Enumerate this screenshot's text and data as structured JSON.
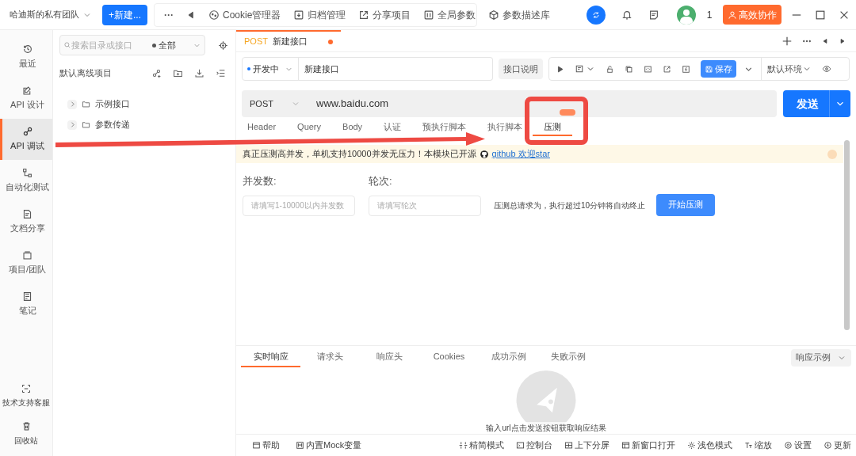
{
  "app_bar": {
    "team": "哈迪斯的私有团队",
    "new_button": "+新建...",
    "more": "···",
    "tools": [
      {
        "label": "Cookie管理器"
      },
      {
        "label": "归档管理"
      },
      {
        "label": "分享项目"
      },
      {
        "label": "全局参数"
      },
      {
        "label": "参数描述库"
      }
    ],
    "user_count": "1",
    "collab_button": "高效协作"
  },
  "nav": {
    "items": [
      {
        "label": "最近",
        "selected": false
      },
      {
        "label": "API 设计",
        "selected": false
      },
      {
        "label": "API 调试",
        "selected": true
      },
      {
        "label": "自动化测试",
        "selected": false
      },
      {
        "label": "文档分享",
        "selected": false
      },
      {
        "label": "项目/团队",
        "selected": false
      },
      {
        "label": "笔记",
        "selected": false
      }
    ],
    "bottom_items": [
      {
        "label": "技术支持客服"
      },
      {
        "label": "回收站"
      }
    ]
  },
  "tree": {
    "search_placeholder": "搜索目录或接口",
    "filter": "全部",
    "project": "默认离线项目",
    "folders": [
      {
        "label": "示例接口",
        "expanded": false
      },
      {
        "label": "参数传递",
        "expanded": false
      }
    ]
  },
  "tab": {
    "method": "POST",
    "name": "新建接口",
    "unsaved": true
  },
  "request": {
    "status": "开发中",
    "name": "新建接口",
    "doc_button": "接口说明",
    "save_button": "保存",
    "environment": "默认环境",
    "method": "POST",
    "url": "www.baidu.com",
    "send_button": "发送"
  },
  "request_tabs": [
    {
      "label": "Header",
      "selected": false,
      "badge": false
    },
    {
      "label": "Query",
      "selected": false,
      "badge": false
    },
    {
      "label": "Body",
      "selected": false,
      "badge": false
    },
    {
      "label": "认证",
      "selected": false,
      "badge": false
    },
    {
      "label": "预执行脚本",
      "selected": false,
      "badge": false
    },
    {
      "label": "执行脚本",
      "selected": false,
      "badge": false
    },
    {
      "label": "压测",
      "selected": true,
      "badge": true
    }
  ],
  "banner": {
    "text": "真正压测高并发，单机支持10000并发无压力！本模块已开源",
    "link": "github 欢迎star"
  },
  "load_test": {
    "concurrency_label": "并发数:",
    "concurrency_placeholder": "请填写1-10000以内并发数",
    "rounds_label": "轮次:",
    "rounds_placeholder": "请填写轮次",
    "note": "压测总请求为，执行超过10分钟将自动终止",
    "start_button": "开始压测"
  },
  "response": {
    "tabs": [
      {
        "label": "实时响应",
        "selected": true
      },
      {
        "label": "请求头",
        "selected": false
      },
      {
        "label": "响应头",
        "selected": false
      },
      {
        "label": "Cookies",
        "selected": false
      },
      {
        "label": "成功示例",
        "selected": false
      },
      {
        "label": "失败示例",
        "selected": false
      }
    ],
    "example_select": "响应示例",
    "empty_text": "输入url点击发送按钮获取响应结果"
  },
  "status_bar": {
    "left": [
      {
        "label": "帮助"
      },
      {
        "label": "内置Mock变量"
      }
    ],
    "right": [
      {
        "label": "精简模式"
      },
      {
        "label": "控制台"
      },
      {
        "label": "上下分屏"
      },
      {
        "label": "新窗口打开"
      },
      {
        "label": "浅色模式"
      },
      {
        "label": "缩放"
      },
      {
        "label": "设置"
      },
      {
        "label": "更新"
      }
    ]
  }
}
